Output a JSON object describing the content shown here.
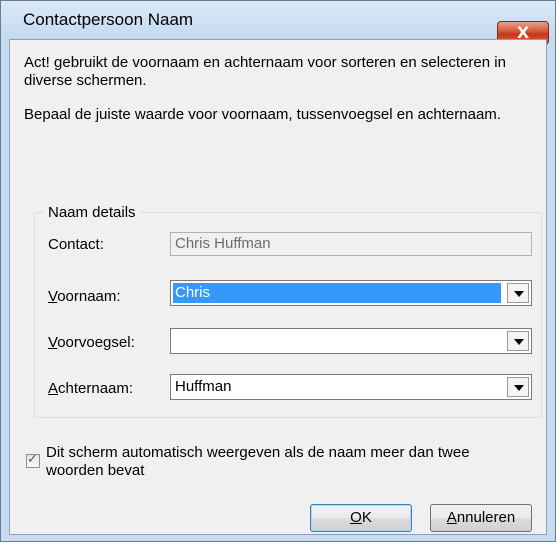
{
  "window": {
    "title": "Contactpersoon Naam",
    "close_glyph": "X"
  },
  "intro": {
    "paragraph1": "Act! gebruikt de voornaam en achternaam voor sorteren en selecteren in diverse schermen.",
    "paragraph2": "Bepaal de juiste waarde voor voornaam, tussenvoegsel en achternaam."
  },
  "group": {
    "legend": "Naam details",
    "contact_label": "Contact:",
    "contact_value": "Chris Huffman",
    "voornaam_label_mnemonic": "V",
    "voornaam_label_rest": "oornaam:",
    "voornaam_value": "Chris",
    "voorvoegsel_label_mnemonic": "V",
    "voorvoegsel_label_rest": "oorvoegsel:",
    "voorvoegsel_value": "",
    "achternaam_label_mnemonic": "A",
    "achternaam_label_rest": "chternaam:",
    "achternaam_value": "Huffman"
  },
  "auto_show": {
    "label": "Dit scherm automatisch weergeven als de naam meer dan twee woorden bevat",
    "checked": true
  },
  "buttons": {
    "ok_mnemonic": "O",
    "ok_rest": "K",
    "cancel_mnemonic": "A",
    "cancel_rest": "nnuleren"
  }
}
